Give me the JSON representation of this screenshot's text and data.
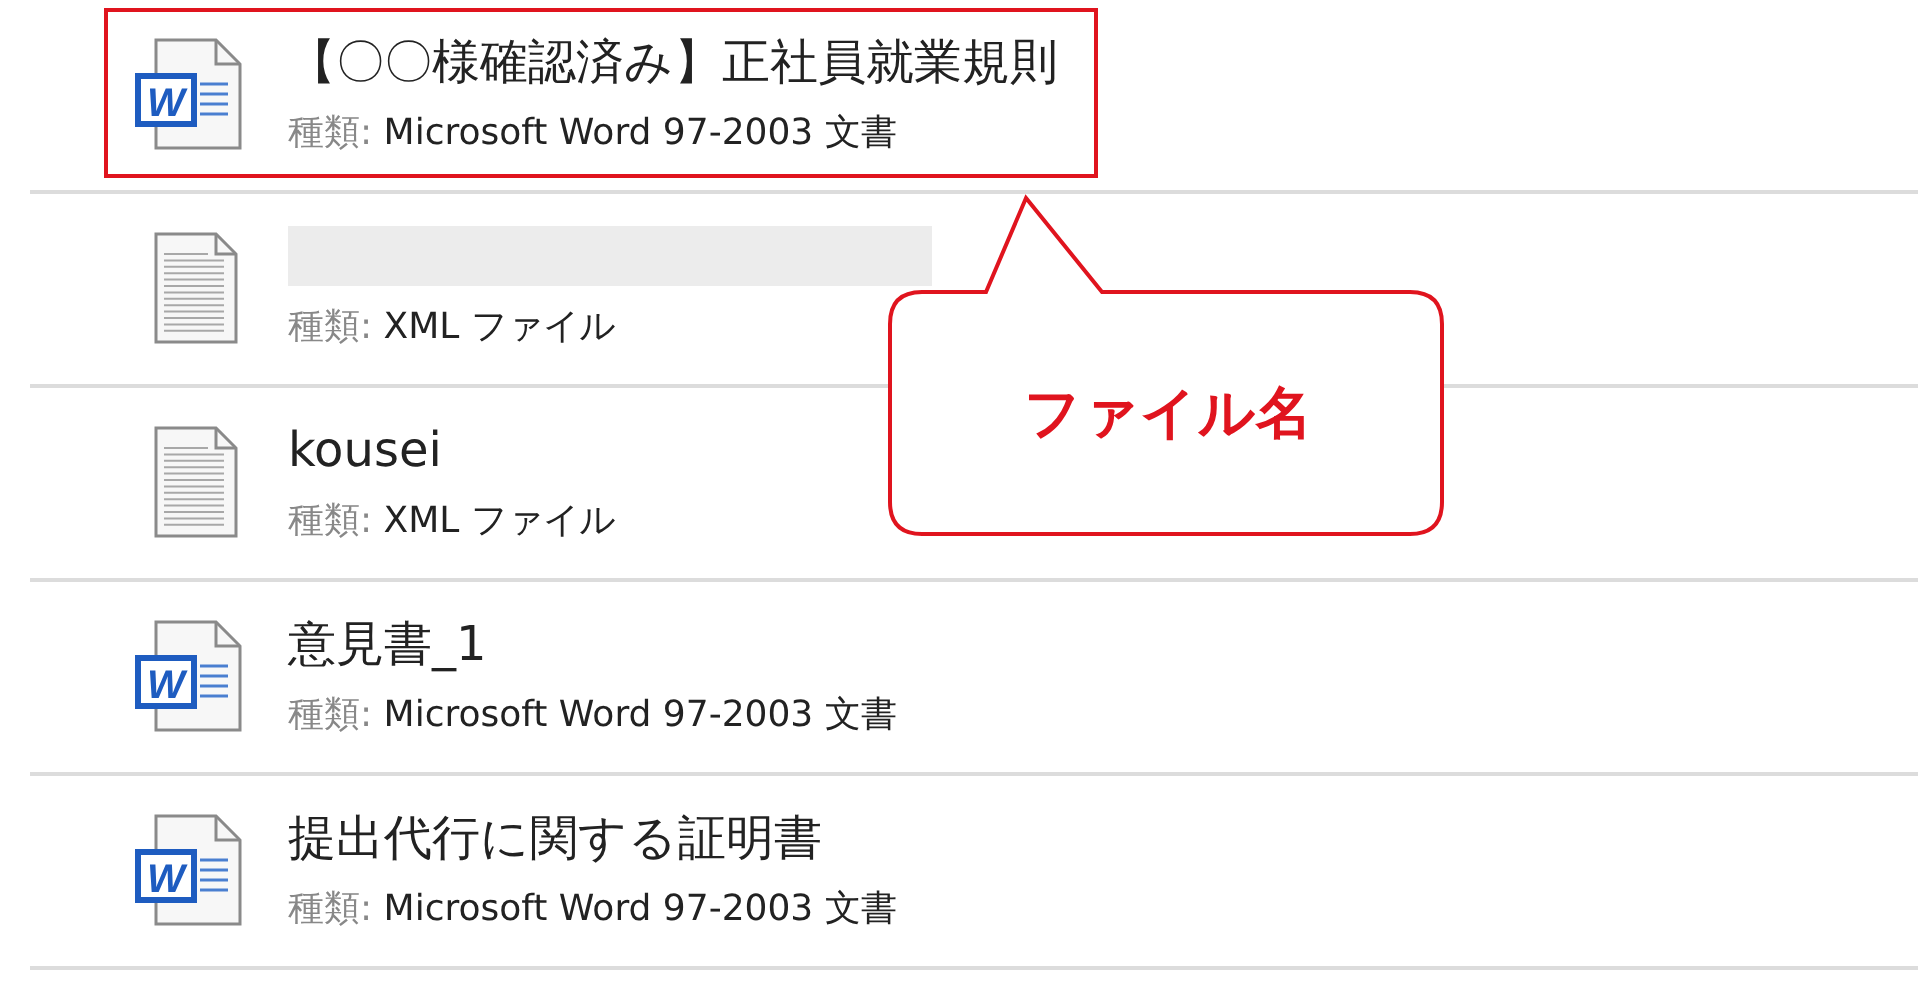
{
  "files": [
    {
      "kind": "word",
      "icon_letter": "W",
      "name": "【〇〇様確認済み】正社員就業規則",
      "name_redacted": false,
      "type_label": "種類:",
      "type": "Microsoft Word 97-2003 文書",
      "highlighted": true
    },
    {
      "kind": "text",
      "name_redacted": true,
      "type_label": "種類:",
      "type": "XML ファイル",
      "highlighted": false
    },
    {
      "kind": "text",
      "name": "kousei",
      "name_redacted": false,
      "type_label": "種類:",
      "type": "XML ファイル",
      "highlighted": false
    },
    {
      "kind": "word",
      "icon_letter": "W",
      "name": "意見書_1",
      "name_redacted": false,
      "type_label": "種類:",
      "type": "Microsoft Word 97-2003 文書",
      "highlighted": false
    },
    {
      "kind": "word",
      "icon_letter": "W",
      "name": "提出代行に関する証明書",
      "name_redacted": false,
      "type_label": "種類:",
      "type": "Microsoft Word 97-2003 文書",
      "highlighted": false
    }
  ],
  "callout": {
    "text": "ファイル名"
  }
}
